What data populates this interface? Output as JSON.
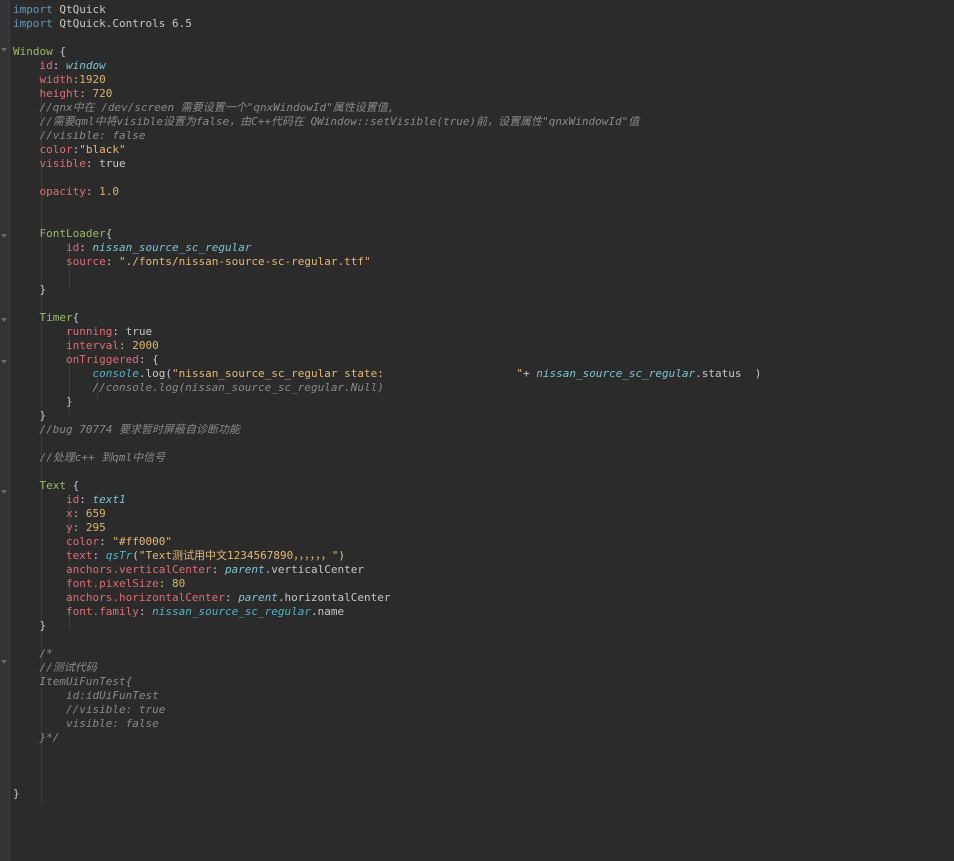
{
  "editor": {
    "lines": [
      [
        {
          "t": "import",
          "c": "kw"
        },
        {
          "t": " QtQuick",
          "c": "plain"
        }
      ],
      [
        {
          "t": "import",
          "c": "kw"
        },
        {
          "t": " QtQuick.Controls 6.5",
          "c": "plain"
        }
      ],
      [],
      [
        {
          "t": "Window",
          "c": "type"
        },
        {
          "t": " {",
          "c": "plain"
        }
      ],
      [
        {
          "t": "    ",
          "c": "plain"
        },
        {
          "t": "id",
          "c": "prop"
        },
        {
          "t": ": ",
          "c": "plain"
        },
        {
          "t": "window",
          "c": "id"
        }
      ],
      [
        {
          "t": "    ",
          "c": "plain"
        },
        {
          "t": "width",
          "c": "prop"
        },
        {
          "t": ":1920",
          "c": "num"
        }
      ],
      [
        {
          "t": "    ",
          "c": "plain"
        },
        {
          "t": "height",
          "c": "prop"
        },
        {
          "t": ": 720",
          "c": "num"
        }
      ],
      [
        {
          "t": "    //qnx中在 /dev/screen 需要设置一个\"qnxWindowId\"属性设置值,",
          "c": "com"
        }
      ],
      [
        {
          "t": "    //需要qml中将visible设置为false，由C++代码在 QWindow::setVisible(true)前，设置属性\"qnxWindowId\"值",
          "c": "com"
        }
      ],
      [
        {
          "t": "    //visible: false",
          "c": "com"
        }
      ],
      [
        {
          "t": "    ",
          "c": "plain"
        },
        {
          "t": "color",
          "c": "prop"
        },
        {
          "t": ":",
          "c": "plain"
        },
        {
          "t": "\"black\"",
          "c": "str"
        }
      ],
      [
        {
          "t": "    ",
          "c": "plain"
        },
        {
          "t": "visible",
          "c": "prop"
        },
        {
          "t": ": true",
          "c": "plain"
        }
      ],
      [],
      [
        {
          "t": "    ",
          "c": "plain"
        },
        {
          "t": "opacity",
          "c": "prop"
        },
        {
          "t": ": 1.0",
          "c": "num"
        }
      ],
      [],
      [],
      [
        {
          "t": "    ",
          "c": "plain"
        },
        {
          "t": "FontLoader",
          "c": "type"
        },
        {
          "t": "{",
          "c": "plain"
        }
      ],
      [
        {
          "t": "        ",
          "c": "plain"
        },
        {
          "t": "id",
          "c": "prop"
        },
        {
          "t": ": ",
          "c": "plain"
        },
        {
          "t": "nissan_source_sc_regular",
          "c": "id"
        }
      ],
      [
        {
          "t": "        ",
          "c": "plain"
        },
        {
          "t": "source",
          "c": "prop"
        },
        {
          "t": ": ",
          "c": "plain"
        },
        {
          "t": "\"./fonts/nissan-source-sc-regular.ttf\"",
          "c": "str"
        }
      ],
      [],
      [
        {
          "t": "    }",
          "c": "plain"
        }
      ],
      [],
      [
        {
          "t": "    ",
          "c": "plain"
        },
        {
          "t": "Timer",
          "c": "type"
        },
        {
          "t": "{",
          "c": "plain"
        }
      ],
      [
        {
          "t": "        ",
          "c": "plain"
        },
        {
          "t": "running",
          "c": "prop"
        },
        {
          "t": ": true",
          "c": "plain"
        }
      ],
      [
        {
          "t": "        ",
          "c": "plain"
        },
        {
          "t": "interval",
          "c": "prop"
        },
        {
          "t": ": 2000",
          "c": "num"
        }
      ],
      [
        {
          "t": "        ",
          "c": "plain"
        },
        {
          "t": "onTriggered",
          "c": "prop"
        },
        {
          "t": ": {",
          "c": "plain"
        }
      ],
      [
        {
          "t": "            ",
          "c": "plain"
        },
        {
          "t": "console",
          "c": "fn"
        },
        {
          "t": ".log(",
          "c": "plain"
        },
        {
          "t": "\"nissan_source_sc_regular state:                    \"",
          "c": "str"
        },
        {
          "t": "+ ",
          "c": "plain"
        },
        {
          "t": "nissan_source_sc_regular",
          "c": "id"
        },
        {
          "t": ".status  )",
          "c": "plain"
        }
      ],
      [
        {
          "t": "            //console.log(nissan_source_sc_regular.Null)",
          "c": "com"
        }
      ],
      [
        {
          "t": "        }",
          "c": "plain"
        }
      ],
      [
        {
          "t": "    }",
          "c": "plain"
        }
      ],
      [
        {
          "t": "    //bug 70774 要求暂时屏蔽自诊断功能",
          "c": "com"
        }
      ],
      [],
      [
        {
          "t": "    //处理c++ 到qml中信号",
          "c": "com"
        }
      ],
      [],
      [
        {
          "t": "    ",
          "c": "plain"
        },
        {
          "t": "Text",
          "c": "type"
        },
        {
          "t": " {",
          "c": "plain"
        }
      ],
      [
        {
          "t": "        ",
          "c": "plain"
        },
        {
          "t": "id",
          "c": "prop"
        },
        {
          "t": ": ",
          "c": "plain"
        },
        {
          "t": "text1",
          "c": "id"
        }
      ],
      [
        {
          "t": "        ",
          "c": "plain"
        },
        {
          "t": "x",
          "c": "prop"
        },
        {
          "t": ": 659",
          "c": "num"
        }
      ],
      [
        {
          "t": "        ",
          "c": "plain"
        },
        {
          "t": "y",
          "c": "prop"
        },
        {
          "t": ": 295",
          "c": "num"
        }
      ],
      [
        {
          "t": "        ",
          "c": "plain"
        },
        {
          "t": "color",
          "c": "prop"
        },
        {
          "t": ": ",
          "c": "plain"
        },
        {
          "t": "\"#ff0000\"",
          "c": "str"
        }
      ],
      [
        {
          "t": "        ",
          "c": "plain"
        },
        {
          "t": "text",
          "c": "prop"
        },
        {
          "t": ": ",
          "c": "plain"
        },
        {
          "t": "qsTr",
          "c": "fn"
        },
        {
          "t": "(",
          "c": "plain"
        },
        {
          "t": "\"Text测试用中文1234567890，，，，，，\"",
          "c": "str"
        },
        {
          "t": ")",
          "c": "plain"
        }
      ],
      [
        {
          "t": "        ",
          "c": "plain"
        },
        {
          "t": "anchors.verticalCenter",
          "c": "prop"
        },
        {
          "t": ": ",
          "c": "plain"
        },
        {
          "t": "parent",
          "c": "id"
        },
        {
          "t": ".verticalCenter",
          "c": "plain"
        }
      ],
      [
        {
          "t": "        ",
          "c": "plain"
        },
        {
          "t": "font.pixelSize",
          "c": "prop"
        },
        {
          "t": ": 80",
          "c": "num"
        }
      ],
      [
        {
          "t": "        ",
          "c": "plain"
        },
        {
          "t": "anchors.horizontalCenter",
          "c": "prop"
        },
        {
          "t": ": ",
          "c": "plain"
        },
        {
          "t": "parent",
          "c": "id"
        },
        {
          "t": ".horizontalCenter",
          "c": "plain"
        }
      ],
      [
        {
          "t": "        ",
          "c": "plain"
        },
        {
          "t": "font.family",
          "c": "prop"
        },
        {
          "t": ": ",
          "c": "plain"
        },
        {
          "t": "nissan_source_sc_regular",
          "c": "fn"
        },
        {
          "t": ".name",
          "c": "plain"
        }
      ],
      [
        {
          "t": "    }",
          "c": "plain"
        }
      ],
      [],
      [
        {
          "t": "    /*",
          "c": "com"
        }
      ],
      [
        {
          "t": "    //测试代码",
          "c": "com"
        }
      ],
      [
        {
          "t": "    ItemUiFunTest{",
          "c": "com"
        }
      ],
      [
        {
          "t": "        id:idUiFunTest",
          "c": "com"
        }
      ],
      [
        {
          "t": "        //visible: true",
          "c": "com"
        }
      ],
      [
        {
          "t": "        visible: false",
          "c": "com"
        }
      ],
      [
        {
          "t": "    }*/",
          "c": "com"
        }
      ],
      [],
      [],
      [],
      [
        {
          "t": "}",
          "c": "plain"
        }
      ]
    ]
  },
  "colors": {
    "background": "#2b2b2b",
    "keyword": "#6897bb",
    "type": "#9aba64",
    "property": "#e06c75",
    "string": "#e6b872",
    "comment": "#8a8a8a",
    "identifier": "#7ec4d3"
  }
}
